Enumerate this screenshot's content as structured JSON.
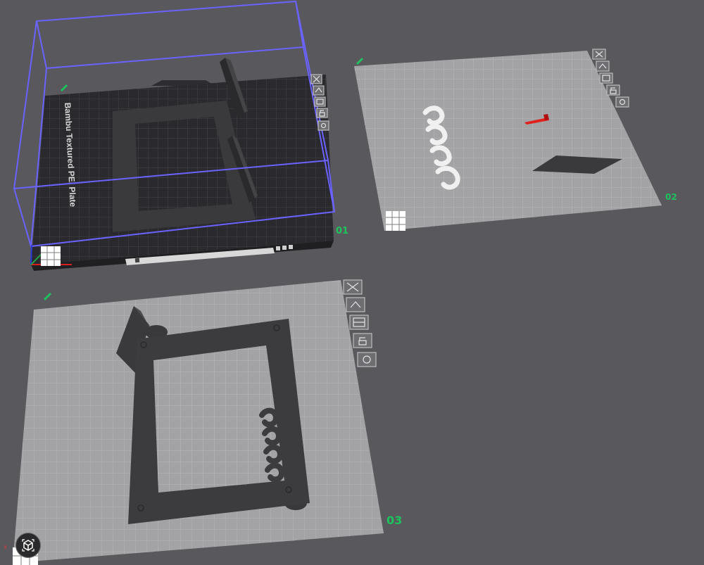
{
  "viewport": {
    "plates": [
      {
        "id": "plate-01",
        "label": "01",
        "bed_name": "Bambu Textured PEI Plate",
        "active": true
      },
      {
        "id": "plate-02",
        "label": "02",
        "active": false
      },
      {
        "id": "plate-03",
        "label": "03",
        "active": false
      }
    ],
    "plate_tools": [
      "close-plate",
      "auto-orient",
      "arrange",
      "lock",
      "settings"
    ],
    "axis_x_label": "x",
    "colors": {
      "background": "#58585d",
      "plate_active": "#2b2b2f",
      "plate_inactive": "#a3a3a6",
      "grid_active": "#3d3d42",
      "grid_inactive": "#b6b6b9",
      "plate_label": "#1ec35e",
      "bounding_box": "#6a63ff",
      "model_dark": "#3a3a3c",
      "model_light": "#ececec",
      "model_red": "#e0201c"
    }
  }
}
